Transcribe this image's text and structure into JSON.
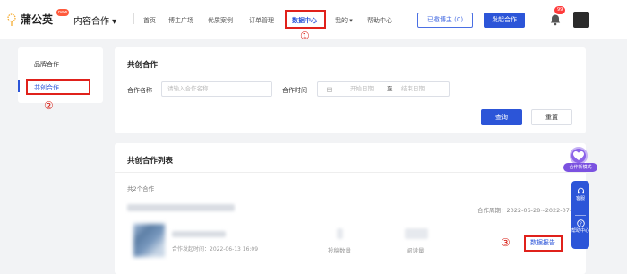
{
  "header": {
    "logo_text": "蒲公英",
    "logo_badge": "new",
    "product_switch": "内容合作 ▾",
    "nav": [
      {
        "label": "首页"
      },
      {
        "label": "博主广场"
      },
      {
        "label": "优质案例"
      },
      {
        "label": "订单管理"
      },
      {
        "label": "数据中心"
      },
      {
        "label": "我的 ▾"
      },
      {
        "label": "帮助中心"
      }
    ],
    "active_nav": "数据中心",
    "invited_button": "已邀博主 (0)",
    "start_coop_button": "发起合作",
    "bell_badge": "99",
    "annotation_1": "①"
  },
  "sidebar": {
    "items": [
      {
        "label": "品牌合作"
      },
      {
        "label": "共创合作"
      }
    ],
    "active_item": "共创合作",
    "annotation_2": "②"
  },
  "filter": {
    "title": "共创合作",
    "name_label": "合作名称",
    "name_placeholder": "请输入合作名称",
    "time_label": "合作时间",
    "start_placeholder": "开始日期",
    "separator": "至",
    "end_placeholder": "结束日期",
    "query_button": "查询",
    "reset_button": "重置"
  },
  "list": {
    "title": "共创合作列表",
    "total": "共2个合作",
    "items": [
      {
        "period": "合作周期：2022-06-28~2022-07-14",
        "created": "合作发起时间：2022-06-13 16:09",
        "stat_labels": [
          "投稿数量",
          "阅读量"
        ],
        "report_link": "数据报告"
      }
    ],
    "annotation_3": "③"
  },
  "float_widgets": {
    "coop_mode_label": "合作新模式",
    "tools": [
      {
        "label": "客服",
        "icon": "headset-icon"
      },
      {
        "label": "帮助中心",
        "icon": "help-icon"
      }
    ]
  },
  "colors": {
    "brand_blue": "#2c55d8",
    "highlight_red": "#e0211b",
    "background": "#f2f3f5",
    "float_purple": "#8b63e8"
  }
}
